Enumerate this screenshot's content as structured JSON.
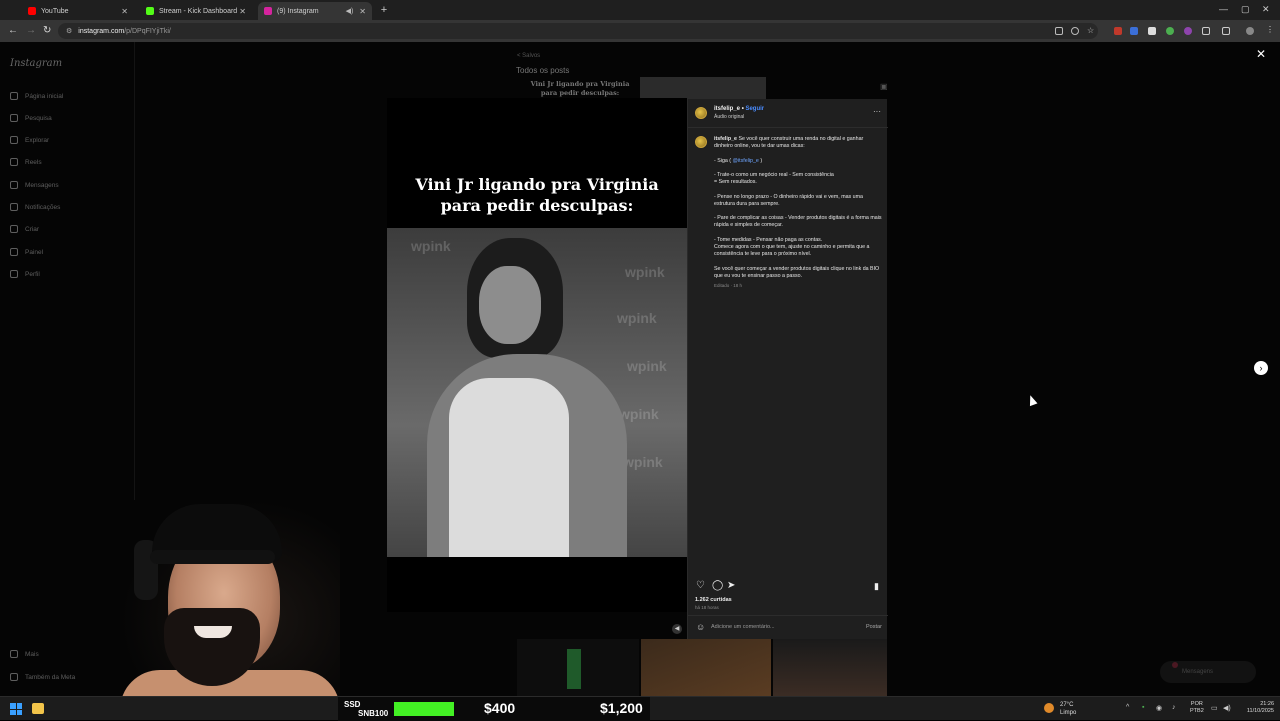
{
  "browser": {
    "tabs": [
      {
        "title": "YouTube",
        "favicon_color": "#ff0000",
        "active": false
      },
      {
        "title": "Stream - Kick Dashboard",
        "favicon_color": "#53fc18",
        "active": false
      },
      {
        "title": "(9) Instagram",
        "favicon_color": "#d6249f",
        "active": true
      }
    ],
    "url_host": "instagram.com",
    "url_path": "/p/DPqFIYjiTki/"
  },
  "instagram": {
    "logo": "Instagram",
    "nav": [
      {
        "label": "Página inicial",
        "icon": "home-icon"
      },
      {
        "label": "Pesquisa",
        "icon": "search-icon"
      },
      {
        "label": "Explorar",
        "icon": "compass-icon"
      },
      {
        "label": "Reels",
        "icon": "reels-icon"
      },
      {
        "label": "Mensagens",
        "icon": "messenger-icon"
      },
      {
        "label": "Notificações",
        "icon": "heart-icon"
      },
      {
        "label": "Criar",
        "icon": "plus-icon"
      },
      {
        "label": "Painel",
        "icon": "dashboard-icon"
      },
      {
        "label": "Perfil",
        "icon": "profile-icon"
      }
    ],
    "more": "Mais",
    "meta": "Também da Meta",
    "saved_back": "< Salvos",
    "saved_title": "Todos os posts",
    "thumb_caption": "Vini Jr ligando pra Virginia para pedir desculpas:",
    "post": {
      "caption_line1": "Vini Jr ligando pra Virginia",
      "caption_line2": "para pedir desculpas:",
      "watermark": "wpink",
      "username": "itsfelip_e",
      "follow": "Seguir",
      "audio": "Áudio original",
      "caption_lines": [
        {
          "user": "itsfelip_e",
          "text": " Se você quer construir uma renda no digital e ganhar dinheiro online, vou te dar umas dicas:"
        },
        {
          "text": ""
        },
        {
          "pre": "- Siga ( ",
          "mention": "@itsfelip_e",
          "post": " )"
        },
        {
          "text": ""
        },
        {
          "text": "- Trate-o como um negócio real - Sem consistência"
        },
        {
          "text": "= Sem resultados."
        },
        {
          "text": ""
        },
        {
          "text": "- Pense no longo prazo - O dinheiro rápido vai e vem, mas uma estrutura dura para sempre."
        },
        {
          "text": ""
        },
        {
          "text": "- Pare de complicar as coisas - Vender produtos digitais é a forma mais rápida e simples de começar."
        },
        {
          "text": ""
        },
        {
          "text": "- Tome medidas - Pensar não paga as contas."
        },
        {
          "text": "Comece agora com o que tem, ajuste no caminho e permita que a consistência te leve para o próximo nível."
        },
        {
          "text": ""
        },
        {
          "text": "Se você quer começar a vender produtos digitais clique no link da BIO que eu vou te ensinar passo a passo."
        }
      ],
      "caption_meta": "Editado · 18 h",
      "likes": "1.262 curtidas",
      "time_ago": "há 18 horas",
      "comment_placeholder": "Adicione um comentário...",
      "post_button": "Postar"
    },
    "messages_pill": "Mensagens"
  },
  "taskbar": {
    "ticker_labels": [
      "SSD",
      "SNB100"
    ],
    "money1": "$400",
    "money2": "$1,200",
    "temp": "27°C",
    "weather": "Limpo",
    "lang1": "POR",
    "lang2": "PTB2",
    "time": "21:26",
    "date": "11/10/2025"
  }
}
